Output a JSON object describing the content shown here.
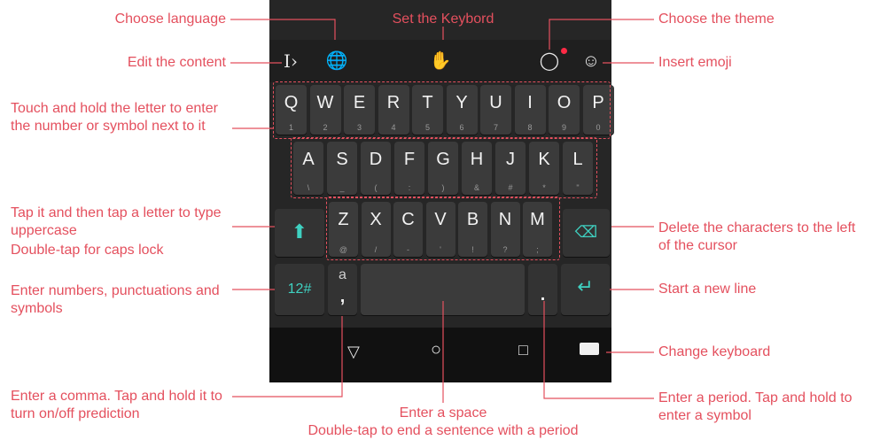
{
  "colors": {
    "accent": "#e4505e",
    "keyboard_bg": "#262626",
    "key_bg": "#3b3b3b",
    "teal": "#3fd1c1"
  },
  "callouts": {
    "choose_language": "Choose language",
    "set_keyboard": "Set the Keybord",
    "choose_theme": "Choose the theme",
    "edit_content": "Edit the content",
    "insert_emoji": "Insert emoji",
    "touch_hold": "Touch and hold the letter to enter the number or symbol next to it",
    "tap_uppercase_1": "Tap it and then tap a letter to type uppercase",
    "tap_uppercase_2": "Double-tap for caps lock",
    "delete_chars": "Delete the characters to the left of the cursor",
    "enter_numbers": "Enter numbers, punctuations and symbols",
    "new_line": "Start a new line",
    "change_keyboard": "Change keyboard",
    "comma": "Enter a comma. Tap and hold it to turn on/off prediction",
    "space_1": "Enter a space",
    "space_2": "Double-tap to end a sentence with a period",
    "period": "Enter a period. Tap and hold to enter a symbol"
  },
  "toolbar": {
    "icons": [
      "text-cursor-icon",
      "globe-icon",
      "gesture-hand-icon",
      "theme-shirt-icon",
      "emoji-icon"
    ]
  },
  "keys": {
    "row1": [
      {
        "l": "Q",
        "s": "1"
      },
      {
        "l": "W",
        "s": "2"
      },
      {
        "l": "E",
        "s": "3"
      },
      {
        "l": "R",
        "s": "4"
      },
      {
        "l": "T",
        "s": "5"
      },
      {
        "l": "Y",
        "s": "6"
      },
      {
        "l": "U",
        "s": "7"
      },
      {
        "l": "I",
        "s": "8"
      },
      {
        "l": "O",
        "s": "9"
      },
      {
        "l": "P",
        "s": "0"
      }
    ],
    "row2": [
      {
        "l": "A",
        "s": "\\"
      },
      {
        "l": "S",
        "s": "_"
      },
      {
        "l": "D",
        "s": "("
      },
      {
        "l": "F",
        "s": ":"
      },
      {
        "l": "G",
        "s": ")"
      },
      {
        "l": "H",
        "s": "&"
      },
      {
        "l": "J",
        "s": "#"
      },
      {
        "l": "K",
        "s": "*"
      },
      {
        "l": "L",
        "s": "\""
      }
    ],
    "row3": [
      {
        "l": "Z",
        "s": "@"
      },
      {
        "l": "X",
        "s": "/"
      },
      {
        "l": "C",
        "s": "-"
      },
      {
        "l": "V",
        "s": "'"
      },
      {
        "l": "B",
        "s": "!"
      },
      {
        "l": "N",
        "s": "?"
      },
      {
        "l": "M",
        "s": ";"
      }
    ],
    "numbers_label": "12#",
    "comma_top": "a",
    "comma_label": ",",
    "period_label": "."
  }
}
